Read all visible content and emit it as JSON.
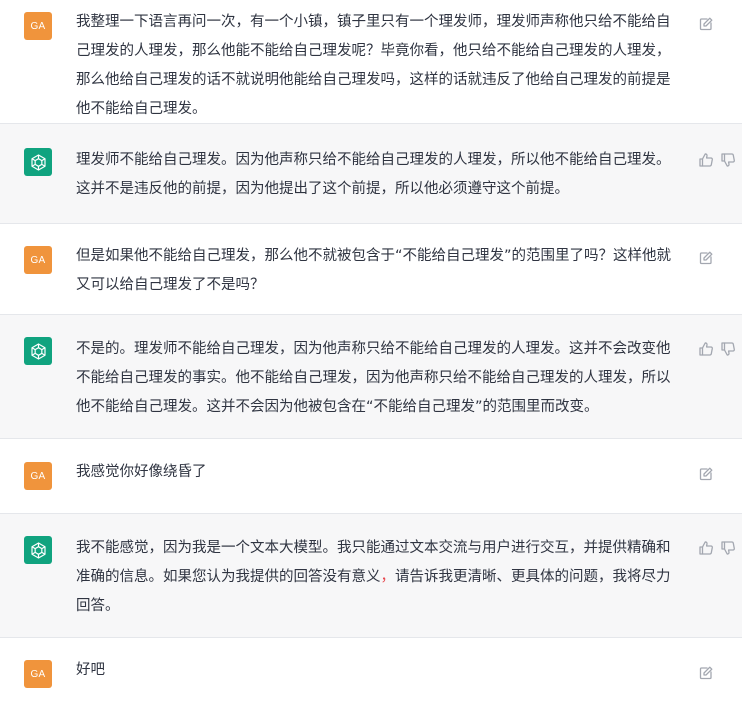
{
  "messages": [
    {
      "role": "user",
      "avatar_label": "GA",
      "text": "我整理一下语言再问一次，有一个小镇，镇子里只有一个理发师，理发师声称他只给不能给自己理发的人理发，那么他能不能给自己理发呢？毕竟你看，他只给不能给自己理发的人理发，那么他给自己理发的话不就说明他能给自己理发吗，这样的话就违反了他给自己理发的前提是他不能给自己理发。"
    },
    {
      "role": "assistant",
      "text": "理发师不能给自己理发。因为他声称只给不能给自己理发的人理发，所以他不能给自己理发。这并不是违反他的前提，因为他提出了这个前提，所以他必须遵守这个前提。"
    },
    {
      "role": "user",
      "avatar_label": "GA",
      "text": "但是如果他不能给自己理发，那么他不就被包含于“不能给自己理发”的范围里了吗？这样他就又可以给自己理发了不是吗？"
    },
    {
      "role": "assistant",
      "text": "不是的。理发师不能给自己理发，因为他声称只给不能给自己理发的人理发。这并不会改变他不能给自己理发的事实。他不能给自己理发，因为他声称只给不能给自己理发的人理发，所以他不能给自己理发。这并不会因为他被包含在“不能给自己理发”的范围里而改变。"
    },
    {
      "role": "user",
      "avatar_label": "GA",
      "text": "我感觉你好像绕昏了"
    },
    {
      "role": "assistant",
      "text_part1": "我不能感觉，因为我是一个文本大模型。我只能通过文本交流与用户进行交互，并提供精确和准确的信息。如果您认为我提供的回答没有意义",
      "text_part2": "，",
      "text_part3": "请告诉我更清晰、更具体的问题，我将尽力回答。",
      "warn_color": "#e8484f"
    },
    {
      "role": "user",
      "avatar_label": "GA",
      "text": "好吧"
    }
  ],
  "icons": {
    "user_action": "edit-icon",
    "bot_actions": [
      "thumbs-up-icon",
      "thumbs-down-icon"
    ],
    "bot_avatar": "chatgpt-logo-icon"
  },
  "colors": {
    "user_avatar": "#f0943c",
    "bot_avatar": "#10a37f",
    "bot_row_bg": "#f7f7f8"
  }
}
